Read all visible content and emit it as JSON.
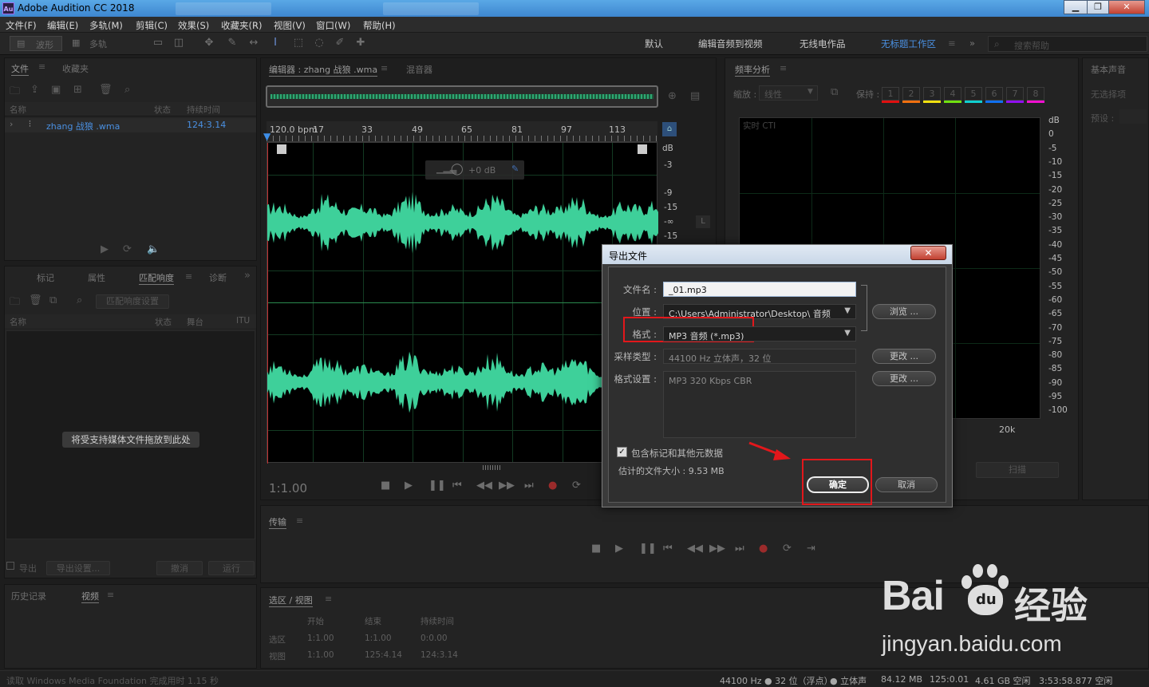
{
  "app": {
    "icon_text": "Au",
    "title": "Adobe Audition CC 2018"
  },
  "window_controls": {
    "minimize": "▁",
    "restore": "❐",
    "close": "✕"
  },
  "menu": [
    "文件(F)",
    "编辑(E)",
    "多轨(M)",
    "剪辑(C)",
    "效果(S)",
    "收藏夹(R)",
    "视图(V)",
    "窗口(W)",
    "帮助(H)"
  ],
  "toolbar": {
    "waveform": "波形",
    "multitrack": "多轨"
  },
  "workspaces": {
    "items": [
      "默认",
      "编辑音频到视频",
      "无线电作品",
      "无标题工作区"
    ],
    "active": "无标题工作区",
    "search_placeholder": "搜索帮助"
  },
  "files_panel": {
    "tabs": [
      "文件",
      "收藏夹"
    ],
    "col_name": "名称",
    "col_status": "状态",
    "col_duration": "持续时间",
    "file_name": "zhang 战狼 .wma",
    "file_duration": "124:3.14"
  },
  "match_panel": {
    "tabs": [
      "标记",
      "属性",
      "匹配响度",
      "诊断"
    ],
    "settings_btn": "匹配响度设置",
    "col_name": "名称",
    "col_status": "状态",
    "col_stage": "舞台",
    "col_itu": "ITU",
    "drop_hint": "将受支持媒体文件拖放到此处",
    "export_label": "导出",
    "export_settings": "导出设置...",
    "cancel": "撤消",
    "run": "运行"
  },
  "history_panel": {
    "tabs": [
      "历史记录",
      "视频"
    ]
  },
  "editor": {
    "tab": "编辑器 : zhang 战狼 .wma",
    "mixer": "混音器",
    "bpm": "120.0 bpm",
    "ruler": [
      "17",
      "33",
      "49",
      "65",
      "81",
      "97",
      "113"
    ],
    "db_labels": [
      "dB",
      "-3",
      "-9",
      "-15",
      "-∞",
      "-15"
    ],
    "hud_gain": "+0 dB",
    "timecode": "1:1.00",
    "channel_label": "L"
  },
  "freq_panel": {
    "title": "频率分析",
    "zoom_label": "缩放 :",
    "zoom_value": "线性",
    "hold_label": "保持 :",
    "hold_buttons": [
      "1",
      "2",
      "3",
      "4",
      "5",
      "6",
      "7",
      "8"
    ],
    "hold_colors": [
      "#e01010",
      "#f07010",
      "#f0e010",
      "#70e010",
      "#10d0d0",
      "#1070f0",
      "#9010f0",
      "#f010d0"
    ],
    "realtime": "实时 CTI",
    "db_scale": [
      "dB",
      "0",
      "-5",
      "-10",
      "-15",
      "-20",
      "-25",
      "-30",
      "-35",
      "-40",
      "-45",
      "-50",
      "-55",
      "-60",
      "-65",
      "-70",
      "-75",
      "-80",
      "-85",
      "-90",
      "-95",
      "-100"
    ],
    "freq_tick": "20k",
    "scan": "扫描"
  },
  "right_panel": {
    "items": [
      "基本声音",
      "无选择项",
      "预设 :"
    ]
  },
  "transport_panel": {
    "title": "传输"
  },
  "selection_panel": {
    "title": "选区 / 视图",
    "col_start": "开始",
    "col_end": "结束",
    "col_duration": "持续时间",
    "row_selection": "选区",
    "row_view": "视图",
    "sel_start": "1:1.00",
    "sel_end": "1:1.00",
    "sel_duration": "0:0.00",
    "view_start": "1:1.00",
    "view_end": "125:4.14",
    "view_duration": "124:3.14"
  },
  "status": {
    "left": "读取 Windows Media Foundation 完成用时 1.15 秒",
    "sample": "44100 Hz ● 32 位（浮点）",
    "channels": "● 立体声",
    "size": "84.12 MB",
    "duration": "125:0.01",
    "disk": "4.61 GB 空闲",
    "free_time": "3:53:58.877 空闲"
  },
  "dialog": {
    "title": "导出文件",
    "close": "✕",
    "filename_label": "文件名 :",
    "filename_value": "_01.mp3",
    "location_label": "位置 :",
    "location_value": "C:\\Users\\Administrator\\Desktop\\ 音频",
    "browse": "浏览 ...",
    "format_label": "格式 :",
    "format_value": "MP3 音频 (*.mp3)",
    "sample_label": "采样类型 :",
    "sample_value": "44100 Hz 立体声，32 位",
    "change": "更改 ...",
    "format_settings_label": "格式设置 :",
    "format_settings_value": "MP3 320 Kbps CBR",
    "change2": "更改 ...",
    "include_markers": "包含标记和其他元数据",
    "estimated_size": "估计的文件大小 : 9.53 MB",
    "ok": "确定",
    "cancel": "取消"
  },
  "watermark": {
    "brand": "Bai",
    "paw": "du",
    "cn": "经验",
    "url": "jingyan.baidu.com"
  }
}
